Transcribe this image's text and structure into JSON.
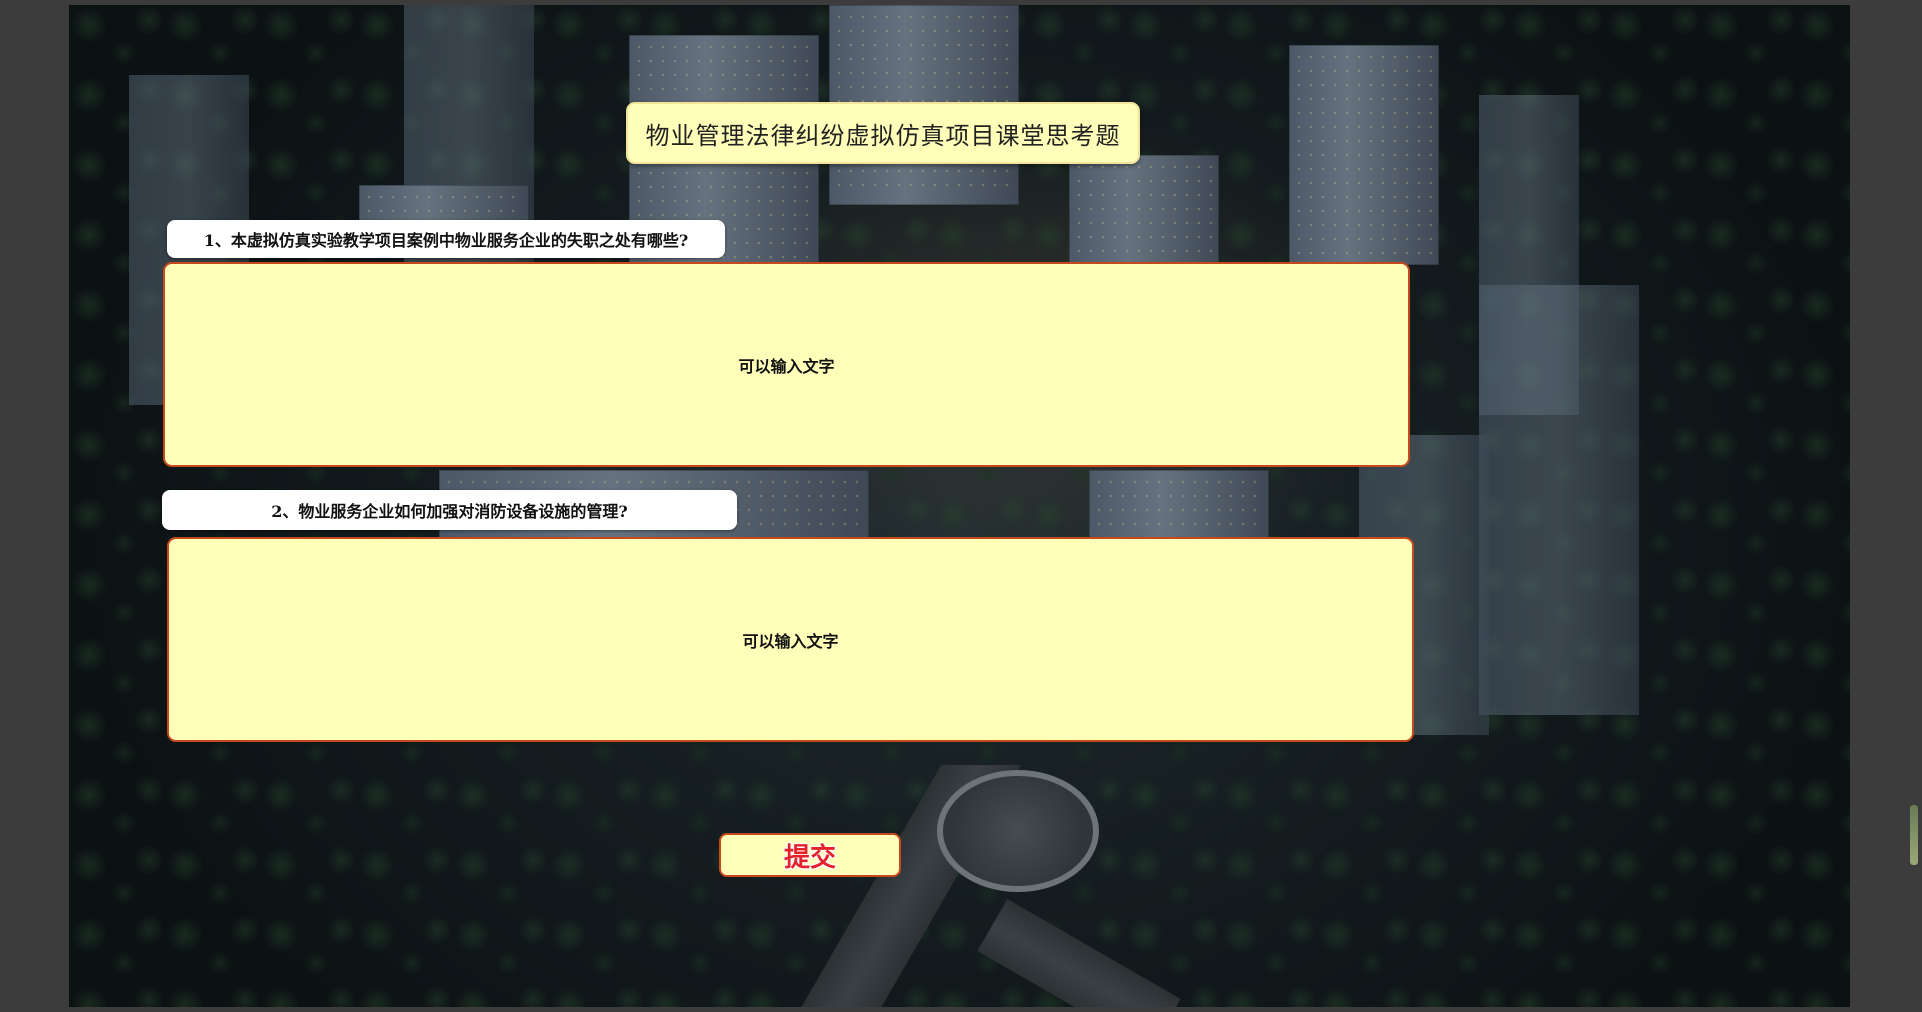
{
  "title": "物业管理法律纠纷虚拟仿真项目课堂思考题",
  "questions": [
    {
      "label": "1、本虚拟仿真实验教学项目案例中物业服务企业的失职之处有哪些?",
      "placeholder": "可以输入文字"
    },
    {
      "label": "2、物业服务企业如何加强对消防设备设施的管理?",
      "placeholder": "可以输入文字"
    }
  ],
  "submit_label": "提交",
  "colors": {
    "panel_fill": "#ffffb9",
    "answer_border": "#c44a1e",
    "submit_text": "#e5222a",
    "label_fill": "#ffffff"
  }
}
